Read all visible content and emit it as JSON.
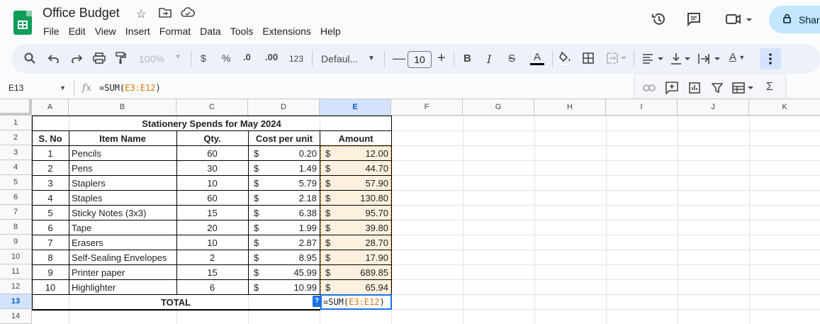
{
  "document": {
    "title": "Office Budget"
  },
  "menu": [
    "File",
    "Edit",
    "View",
    "Insert",
    "Format",
    "Data",
    "Tools",
    "Extensions",
    "Help"
  ],
  "header": {
    "share_label": "Shar"
  },
  "toolbar": {
    "zoom": "100%",
    "currency": "$",
    "percent": "%",
    "decrease_decimal": ".0",
    "increase_decimal": ".00",
    "number_format": "123",
    "font_name": "Defaul...",
    "font_size": "10",
    "bold": "B",
    "italic": "I",
    "strike": "S",
    "text_color": "A",
    "text_rotate": "A"
  },
  "formula_bar": {
    "name_box": "E13",
    "fx": "fx",
    "formula_prefix": "=SUM(",
    "formula_ref": "E3:E12",
    "formula_suffix": ")"
  },
  "columns": [
    "A",
    "B",
    "C",
    "D",
    "E",
    "F",
    "G",
    "H",
    "I",
    "J",
    "K"
  ],
  "rows": [
    "1",
    "2",
    "3",
    "4",
    "5",
    "6",
    "7",
    "8",
    "9",
    "10",
    "11",
    "12",
    "13",
    "14"
  ],
  "sheet": {
    "title": "Stationery Spends for May 2024",
    "headers": {
      "sno": "S. No",
      "item": "Item Name",
      "qty": "Qty.",
      "cost": "Cost per unit",
      "amount": "Amount"
    },
    "currency_symbol": "$",
    "items": [
      {
        "sno": "1",
        "item": "Pencils",
        "qty": "60",
        "cost": "0.20",
        "amount": "12.00"
      },
      {
        "sno": "2",
        "item": "Pens",
        "qty": "30",
        "cost": "1.49",
        "amount": "44.70"
      },
      {
        "sno": "3",
        "item": "Staplers",
        "qty": "10",
        "cost": "5.79",
        "amount": "57.90"
      },
      {
        "sno": "4",
        "item": "Staples",
        "qty": "60",
        "cost": "2.18",
        "amount": "130.80"
      },
      {
        "sno": "5",
        "item": "Sticky Notes (3x3)",
        "qty": "15",
        "cost": "6.38",
        "amount": "95.70"
      },
      {
        "sno": "6",
        "item": "Tape",
        "qty": "20",
        "cost": "1.99",
        "amount": "39.80"
      },
      {
        "sno": "7",
        "item": "Erasers",
        "qty": "10",
        "cost": "2.87",
        "amount": "28.70"
      },
      {
        "sno": "8",
        "item": "Self-Sealing Envelopes",
        "qty": "2",
        "cost": "8.95",
        "amount": "17.90"
      },
      {
        "sno": "9",
        "item": "Printer paper",
        "qty": "15",
        "cost": "45.99",
        "amount": "689.85"
      },
      {
        "sno": "10",
        "item": "Highlighter",
        "qty": "6",
        "cost": "10.99",
        "amount": "65.94"
      }
    ],
    "total_label": "TOTAL",
    "help_badge": "?"
  }
}
